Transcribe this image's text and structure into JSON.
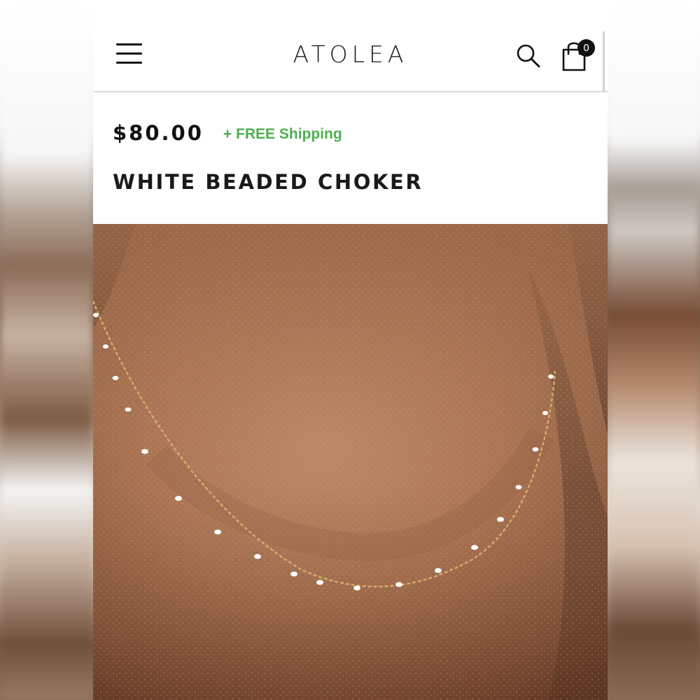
{
  "header": {
    "logo": "ATOLEA",
    "menu_icon": "hamburger-menu-icon",
    "search_icon": "search-icon",
    "cart_icon": "shopping-bag-icon",
    "cart_count": "0"
  },
  "product": {
    "price": "$80.00",
    "shipping_note": "+ FREE Shipping",
    "title": "WHITE BEADED CHOKER"
  },
  "colors": {
    "shipping_green": "#4caf50",
    "text": "#111111",
    "header_divider": "#d9d9d9"
  }
}
